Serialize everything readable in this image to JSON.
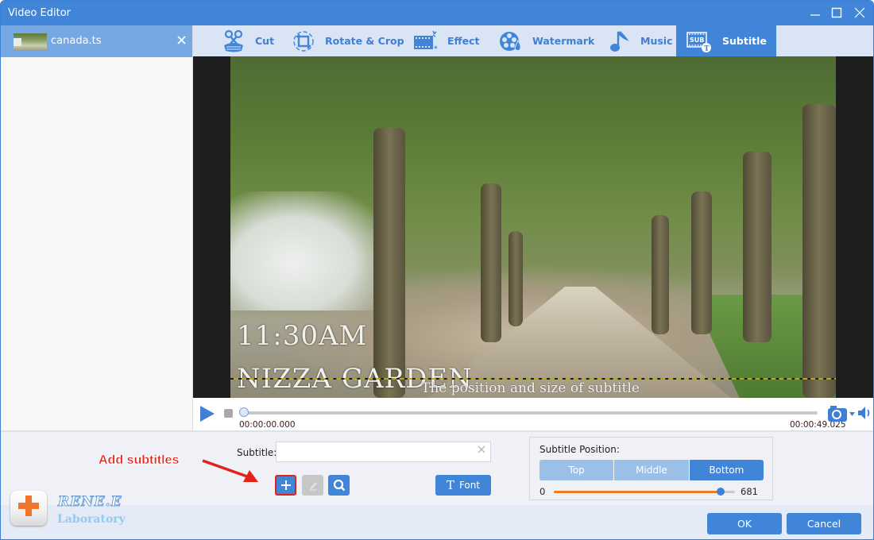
{
  "window": {
    "title": "Video Editor",
    "controls": {
      "minimize": "minimize",
      "maximize": "maximize",
      "close": "close"
    }
  },
  "sidebar": {
    "files": [
      {
        "name": "canada.ts",
        "selected": true
      }
    ]
  },
  "tabs": [
    {
      "label": "Cut",
      "icon": "scissors-icon",
      "active": false
    },
    {
      "label": "Rotate & Crop",
      "icon": "rotate-crop-icon",
      "active": false
    },
    {
      "label": "Effect",
      "icon": "effect-film-icon",
      "active": false
    },
    {
      "label": "Watermark",
      "icon": "watermark-reel-icon",
      "active": false
    },
    {
      "label": "Music",
      "icon": "music-note-icon",
      "active": false
    },
    {
      "label": "Subtitle",
      "icon": "subtitle-icon",
      "active": true
    }
  ],
  "video": {
    "overlay_time": "11:30AM",
    "overlay_place": "NIZZA GARDEN",
    "subtitle_preview": "The position and size of subtitle"
  },
  "player": {
    "current_time": "00:00:00.000",
    "total_time": "00:00:49.025",
    "progress_fraction": 0.0
  },
  "subtitle_panel": {
    "annotation": "Add subtitles",
    "subtitle_label": "Subtitle:",
    "subtitle_value": "",
    "subtitle_placeholder": "",
    "font_label": "Font",
    "position": {
      "title": "Subtitle Position:",
      "options": [
        "Top",
        "Middle",
        "Bottom"
      ],
      "selected": "Bottom",
      "slider_min": "0",
      "slider_max": "681",
      "slider_value_fraction": 0.92
    }
  },
  "brand": {
    "name": "RENE.E",
    "sub": "Laboratory"
  },
  "footer": {
    "ok_label": "OK",
    "cancel_label": "Cancel"
  },
  "colors": {
    "accent": "#4185d9",
    "highlight": "#e2231a",
    "slider_fill": "#f07a1f"
  }
}
